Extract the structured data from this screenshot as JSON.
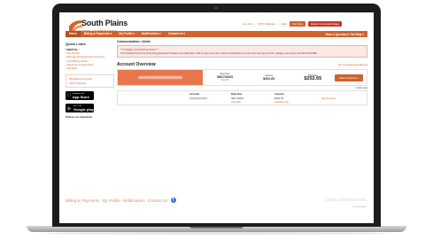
{
  "brand": {
    "name": "South Plains",
    "tagline": "TELEPHONE COOPERATIVE",
    "colors": {
      "accent": "#d0622c",
      "alert": "#c23a2e",
      "bezel": "#1c1c1e"
    }
  },
  "top_links": {
    "logout": "Log Out",
    "site": "SPTC Website",
    "help": "Help",
    "pay_now": "Pay Now",
    "report": "Report An Issue/Outage"
  },
  "nav": {
    "items": [
      "Home",
      "Billing & Payments",
      "My Profile",
      "Notifications",
      "Contact Us"
    ],
    "right": "Have a Question? Get Help"
  },
  "sidebar": {
    "title": "Quick Links",
    "subtitle": "I want to...",
    "links": [
      "Pay My Bill",
      "Manage My Registration Accounts",
      "View Billing History",
      "Report An Outage/Issue",
      "Get Help"
    ],
    "box_links": [
      "Broadband Services",
      "SPTC Website"
    ],
    "app_store": {
      "small": "Download on the",
      "big": "App Store",
      "icon": "apple-icon"
    },
    "google_play": {
      "small": "GET IT ON",
      "big": "Google play",
      "icon": "play-icon"
    },
    "facebook": "Find us on Facebook"
  },
  "communication": {
    "title": "Communication / Alerts",
    "heading": "***UNDER CONSTRUCTION***",
    "body": "This SmartHub site is currently being developed. Please come back Sept. 11th to enjoy your new customer portal where you can view and pay your bill, manage your account and MUCH MORE!"
  },
  "account_overview": {
    "title": "Account Overview",
    "link": "Pay all outstanding balances",
    "next_due_label": "Next Due",
    "next_due_date": "08/17/2023",
    "view_bill": "View Bill",
    "amount_label": "Amount",
    "amount": "$202.65",
    "total_due_label": "Total Due",
    "total_due": "$202.65",
    "make_payment": "Make Payment",
    "view_less": "View Less"
  },
  "detail": {
    "account_label": "Account",
    "date_due_label": "Date Due",
    "date_due": "08/17/2023",
    "view_bill": "View Bill",
    "amount_label": "Amount",
    "amount": "$202.65",
    "autopay": "AutoPay Info",
    "pay_account": "Pay Account"
  },
  "footer": {
    "links": [
      "Billing & Payments",
      "My Profile",
      "Notifications",
      "Contact Us"
    ],
    "facebook_icon": "facebook-icon",
    "call": "Call Us: (806) 963-1001",
    "powered": "Powered by NISC"
  }
}
